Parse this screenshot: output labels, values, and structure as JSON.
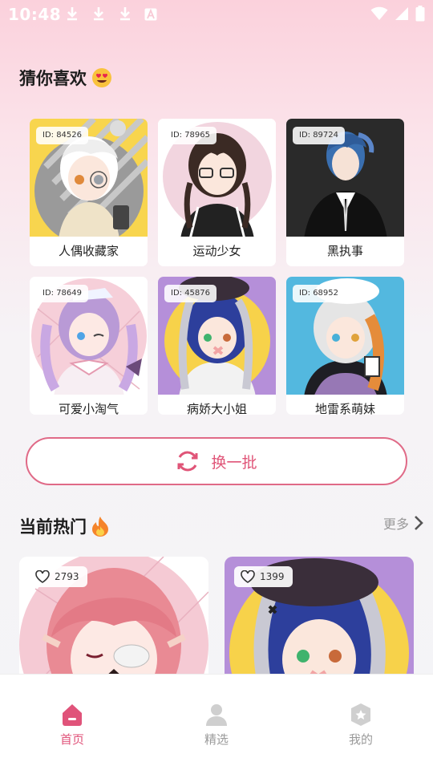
{
  "status": {
    "time": "10:48"
  },
  "colors": {
    "accent": "#e0537a",
    "card_bg": "#ffffff"
  },
  "guess": {
    "title": "猜你喜欢",
    "emoji": "heart-eyes-emoji",
    "cards": [
      {
        "id_text": "ID: 84526",
        "label": "人偶收藏家",
        "bg": "#f8d54e"
      },
      {
        "id_text": "ID: 78965",
        "label": "运动少女",
        "bg": "#f2d5df"
      },
      {
        "id_text": "ID: 89724",
        "label": "黑执事",
        "bg": "#2a2a2a"
      },
      {
        "id_text": "ID: 78649",
        "label": "可爱小淘气",
        "bg": "#f6cfd9"
      },
      {
        "id_text": "ID: 45876",
        "label": "病娇大小姐",
        "bg": "#b58fd9"
      },
      {
        "id_text": "ID: 68952",
        "label": "地雷系萌妹",
        "bg": "#53b8df"
      }
    ],
    "refresh_label": "换一批"
  },
  "hot": {
    "title": "当前热门",
    "emoji": "fire-emoji",
    "more_label": "更多",
    "cards": [
      {
        "likes": "2793",
        "bg": "#f5cad4"
      },
      {
        "likes": "1399",
        "bg": "#b58fd9"
      }
    ]
  },
  "nav": {
    "items": [
      {
        "label": "首页",
        "icon": "home-icon"
      },
      {
        "label": "精选",
        "icon": "person-icon"
      },
      {
        "label": "我的",
        "icon": "badge-icon"
      }
    ]
  }
}
